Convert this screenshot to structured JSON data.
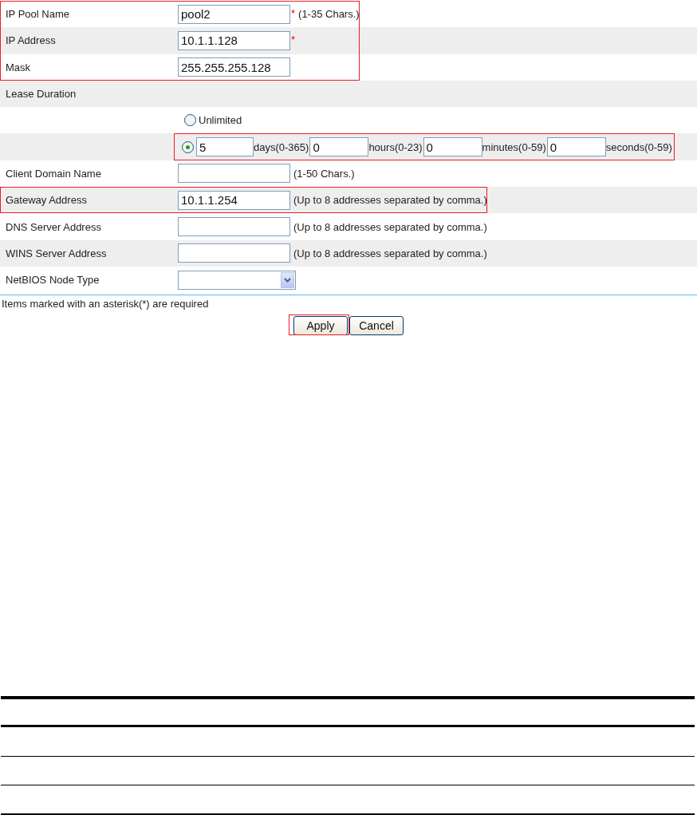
{
  "form": {
    "rows": [
      {
        "kind": "text",
        "label": "IP Pool Name",
        "value": "pool2",
        "required": true,
        "required_mark": "*",
        "hint": "(1-35 Chars.)",
        "shaded": false,
        "highlighted": true
      },
      {
        "kind": "text",
        "label": "IP Address",
        "value": "10.1.1.128",
        "required": true,
        "required_mark": "*",
        "shaded": true,
        "highlighted": true
      },
      {
        "kind": "text",
        "label": "Mask",
        "value": "255.255.255.128",
        "required": false,
        "shaded": false,
        "highlighted": true
      },
      {
        "kind": "section",
        "label": "Lease Duration",
        "shaded": true
      },
      {
        "kind": "radio",
        "option": "Unlimited",
        "selected": false,
        "shaded": false
      },
      {
        "kind": "duration",
        "selected": true,
        "shaded": true,
        "highlighted": true,
        "parts": [
          {
            "value": "5",
            "unit": "days(0-365)"
          },
          {
            "value": "0",
            "unit": "hours(0-23)"
          },
          {
            "value": "0",
            "unit": "minutes(0-59)"
          },
          {
            "value": "0",
            "unit": "seconds(0-59)"
          }
        ]
      },
      {
        "kind": "text",
        "label": "Client Domain Name",
        "required": false,
        "hint": "(1-50 Chars.)",
        "shaded": false
      },
      {
        "kind": "text",
        "label": "Gateway Address",
        "value": "10.1.1.254",
        "required": false,
        "hint": "(Up to 8 addresses separated by comma.)",
        "shaded": true,
        "highlighted": true
      },
      {
        "kind": "text",
        "label": "DNS Server Address",
        "required": false,
        "hint": "(Up to 8 addresses separated by comma.)",
        "shaded": false
      },
      {
        "kind": "text",
        "label": "WINS Server Address",
        "required": false,
        "hint": "(Up to 8 addresses separated by comma.)",
        "shaded": true
      },
      {
        "kind": "select",
        "label": "NetBIOS Node Type",
        "shaded": false
      }
    ],
    "note": "Items marked with an asterisk(*) are required",
    "buttons": [
      {
        "label": "Apply",
        "highlighted": true
      },
      {
        "label": "Cancel",
        "highlighted": false
      }
    ]
  }
}
